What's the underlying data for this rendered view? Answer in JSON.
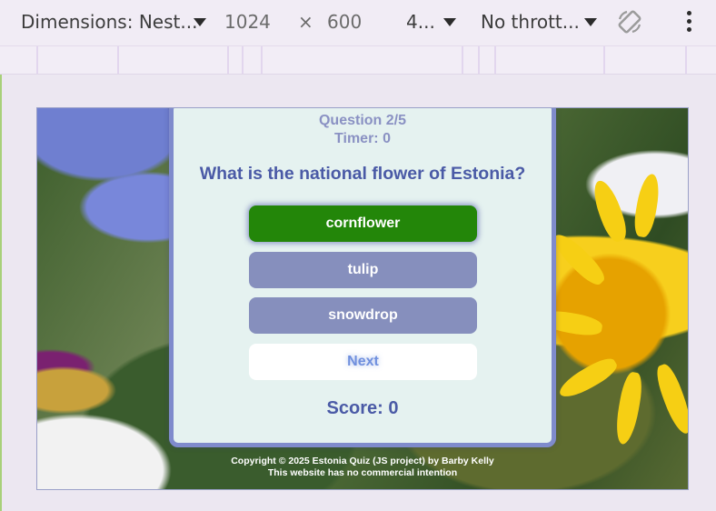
{
  "toolbar": {
    "dimensions_label": "Dimensions: Nest...",
    "width": "1024",
    "times": "×",
    "height": "600",
    "zoom": "4...",
    "throttle": "No thrott...",
    "icons": [
      "chevron-down-icon",
      "rotate-icon",
      "more-vert-icon"
    ]
  },
  "quiz": {
    "question_counter": "Question 2/5",
    "timer": "Timer: 0",
    "question": "What is the national flower of Estonia?",
    "answers": [
      {
        "label": "cornflower",
        "state": "correct"
      },
      {
        "label": "tulip",
        "state": "default"
      },
      {
        "label": "snowdrop",
        "state": "default"
      }
    ],
    "next_label": "Next",
    "score": "Score: 0"
  },
  "footer": {
    "line1": "Copyright © 2025 Estonia Quiz (JS project) by Barby Kelly",
    "line2": "This website has no commercial intention"
  },
  "colors": {
    "correct": "#238609",
    "answer": "#868fbd",
    "card_bg": "#e5f2f0",
    "card_border": "#7f8bcc",
    "heading": "#4a5aa6"
  }
}
